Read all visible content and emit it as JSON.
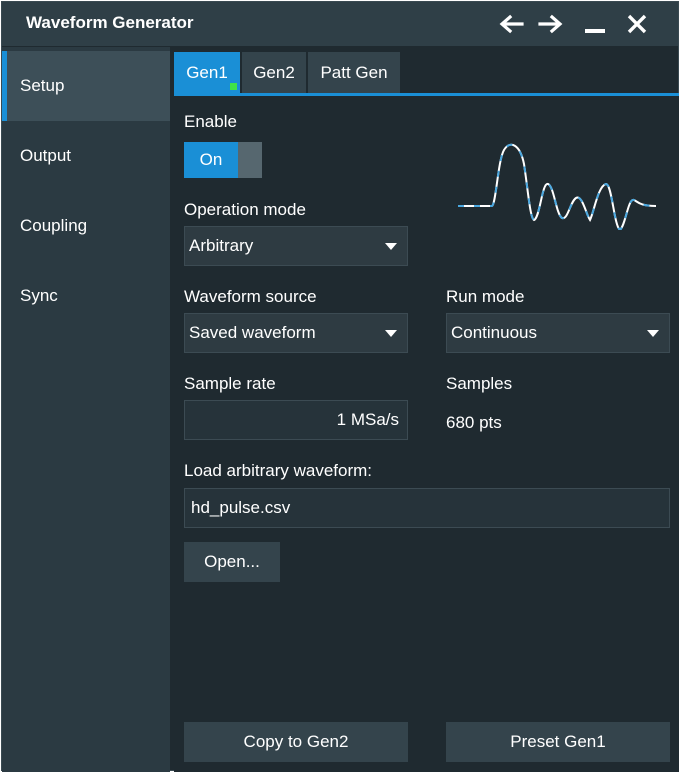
{
  "window": {
    "title": "Waveform Generator"
  },
  "titlebar": {
    "back_icon": "arrow-left-icon",
    "forward_icon": "arrow-right-icon",
    "minimize_icon": "minimize-icon",
    "close_icon": "close-icon"
  },
  "sidebar": {
    "items": [
      {
        "label": "Setup",
        "active": true
      },
      {
        "label": "Output",
        "active": false
      },
      {
        "label": "Coupling",
        "active": false
      },
      {
        "label": "Sync",
        "active": false
      }
    ]
  },
  "tabs": [
    {
      "label": "Gen1",
      "active": true,
      "indicator_color": "#3fe34a"
    },
    {
      "label": "Gen2",
      "active": false
    },
    {
      "label": "Patt Gen",
      "active": false
    }
  ],
  "setup": {
    "enable_label": "Enable",
    "enable_value": "On",
    "operation_mode_label": "Operation mode",
    "operation_mode_value": "Arbitrary",
    "waveform_source_label": "Waveform source",
    "waveform_source_value": "Saved waveform",
    "run_mode_label": "Run mode",
    "run_mode_value": "Continuous",
    "sample_rate_label": "Sample rate",
    "sample_rate_value": "1 MSa/s",
    "samples_label": "Samples",
    "samples_value": "680 pts",
    "load_label": "Load arbitrary waveform:",
    "load_value": "hd_pulse.csv",
    "open_button": "Open...",
    "copy_button": "Copy to Gen2",
    "preset_button": "Preset Gen1",
    "preview_icon": "arbitrary-waveform-preview-icon"
  },
  "colors": {
    "accent": "#1a8fd6",
    "titlebar": "#2f3f47",
    "sidebar": "#2b3a42",
    "panel": "#1f2a30",
    "indicator_green": "#3fe34a"
  }
}
